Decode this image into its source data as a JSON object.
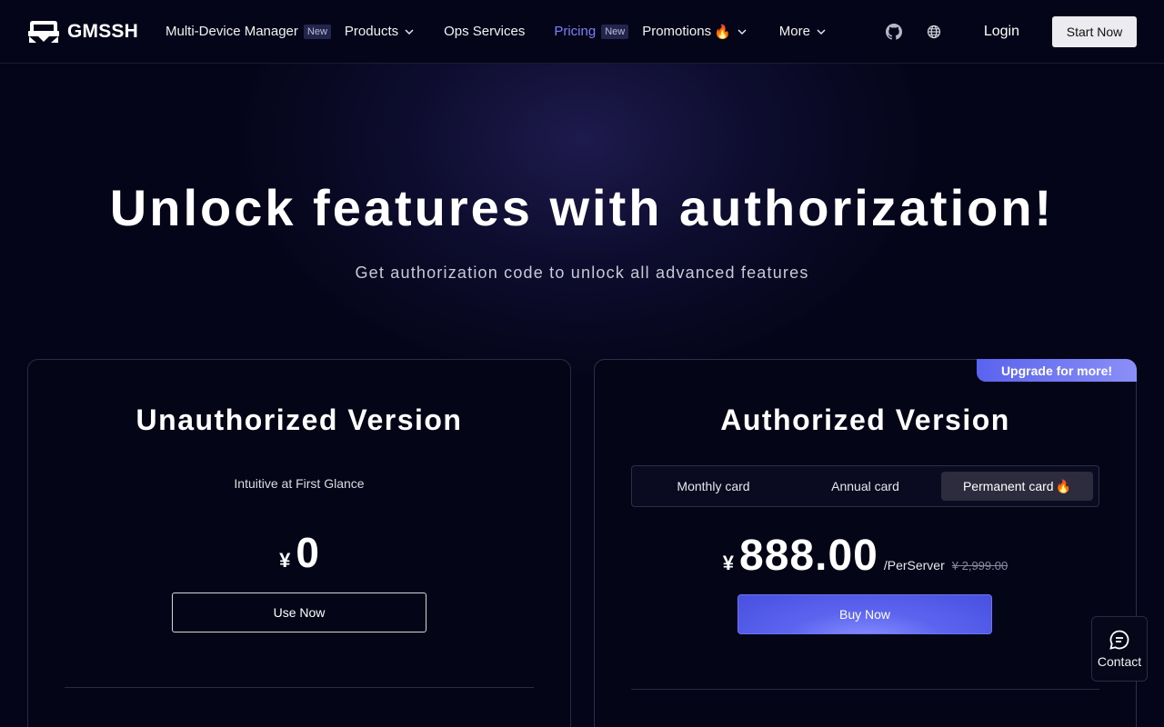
{
  "navbar": {
    "brand": "GMSSH",
    "links": [
      {
        "label": "Multi-Device Manager",
        "badge": "New"
      },
      {
        "label": "Products"
      },
      {
        "label": "Ops Services"
      },
      {
        "label": "Pricing",
        "badge": "New",
        "active": true
      },
      {
        "label": "Promotions",
        "emoji": "🔥"
      },
      {
        "label": "More"
      }
    ],
    "login": "Login",
    "start": "Start Now",
    "icons": [
      "github-icon",
      "globe-icon"
    ]
  },
  "hero": {
    "title": "Unlock features with authorization!",
    "subtitle": "Get authorization code to unlock all advanced features"
  },
  "unauthorized": {
    "title": "Unauthorized Version",
    "desc": "Intuitive at First Glance",
    "currency": "¥",
    "price": "0",
    "button": "Use Now"
  },
  "authorized": {
    "ribbon": "Upgrade for more!",
    "title": "Authorized Version",
    "tabs": [
      "Monthly card",
      "Annual card",
      "Permanent card"
    ],
    "selected_tab": "Permanent card",
    "tab_emoji": "🔥",
    "currency": "¥",
    "price": "888.00",
    "per": "/PerServer",
    "old_price": "¥ 2,999.00",
    "button": "Buy Now"
  },
  "contact": {
    "label": "Contact"
  },
  "colors": {
    "background": "#05051a",
    "accent": "#5c64ef",
    "active_link": "#7c80f5"
  }
}
